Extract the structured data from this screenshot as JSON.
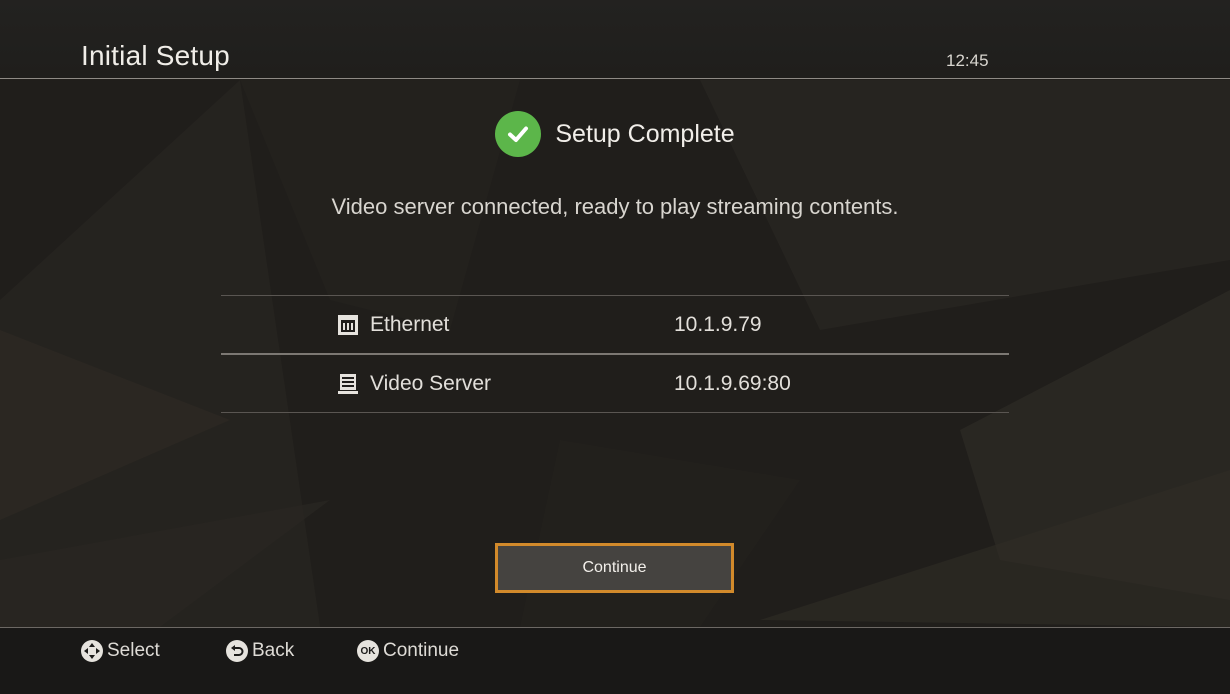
{
  "header": {
    "title": "Initial Setup",
    "clock": "12:45"
  },
  "status": {
    "heading": "Setup Complete",
    "message": "Video server connected, ready to play streaming contents."
  },
  "info": [
    {
      "icon": "ethernet-icon",
      "label": "Ethernet",
      "value": "10.1.9.79"
    },
    {
      "icon": "server-icon",
      "label": "Video Server",
      "value": "10.1.9.69:80"
    }
  ],
  "button": {
    "continue_label": "Continue",
    "focus_color": "#d28a2b"
  },
  "footer": {
    "hints": [
      {
        "icon": "dpad-icon",
        "label": "Select"
      },
      {
        "icon": "back-icon",
        "label": "Back"
      },
      {
        "icon": "ok-icon",
        "icon_text": "OK",
        "label": "Continue"
      }
    ]
  },
  "colors": {
    "success": "#5cb64a",
    "background": "#201e1b"
  }
}
